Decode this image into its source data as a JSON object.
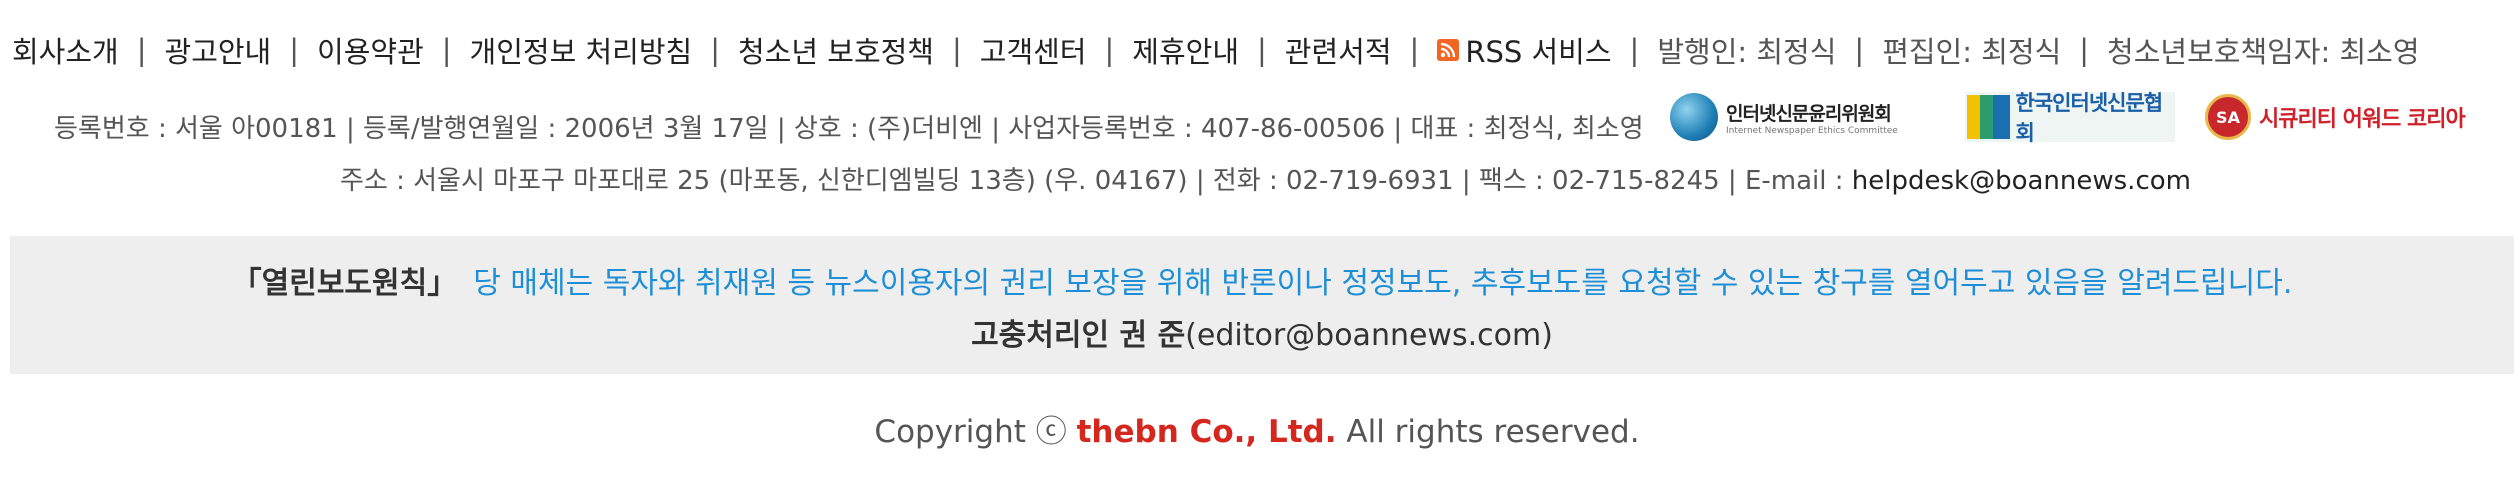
{
  "nav": {
    "links": [
      "회사소개",
      "광고안내",
      "이용약관",
      "개인정보 처리방침",
      "청소년 보호정책",
      "고객센터",
      "제휴안내",
      "관련서적"
    ],
    "rss_label": "RSS 서비스",
    "separator": "|",
    "publisher_info": {
      "publisher": "발행인: 최정식",
      "editor": "편집인: 최정식",
      "youth_officer": "청소년보호책임자: 최소영"
    }
  },
  "company_info": {
    "line1": "등록번호 : 서울 아00181 | 등록/발행연월일 : 2006년 3월 17일 | 상호 : (주)더비엔 | 사업자등록번호 : 407-86-00506 | 대표 : 최정식, 최소영",
    "line2_prefix": "주소 : 서울시 마포구 마포대로 25 (마포동, 신한디엠빌딩 13층) (우. 04167) | 전화 : 02-719-6931 | 팩스 : 02-715-8245 | E-mail : ",
    "email": "helpdesk@boannews.com"
  },
  "logos": [
    {
      "name": "인터넷신문윤리위원회",
      "sub": "Internet Newspaper Ethics Committee",
      "color": "#1f7fb5"
    },
    {
      "name": "한국인터넷신문협회",
      "color": "#1a5fa8"
    },
    {
      "name": "시큐리티 어워드 코리아",
      "badge": "SA",
      "color": "#d0202a"
    }
  ],
  "notice": {
    "title": "「열린보도원칙」",
    "text": "당 매체는 독자와 취재원 등 뉴스이용자의 권리 보장을 위해 반론이나 정정보도, 추후보도를 요청할 수 있는 창구를 열어두고 있음을 알려드립니다.",
    "contact_label": "고충처리인 권 준",
    "contact_email": "(editor@boannews.com)",
    "text_color": "#1e8fd6"
  },
  "copyright": {
    "prefix": "Copyright ⓒ ",
    "company": "thebn Co., Ltd.",
    "suffix": " All rights reserved.",
    "company_color": "#d4281f"
  }
}
